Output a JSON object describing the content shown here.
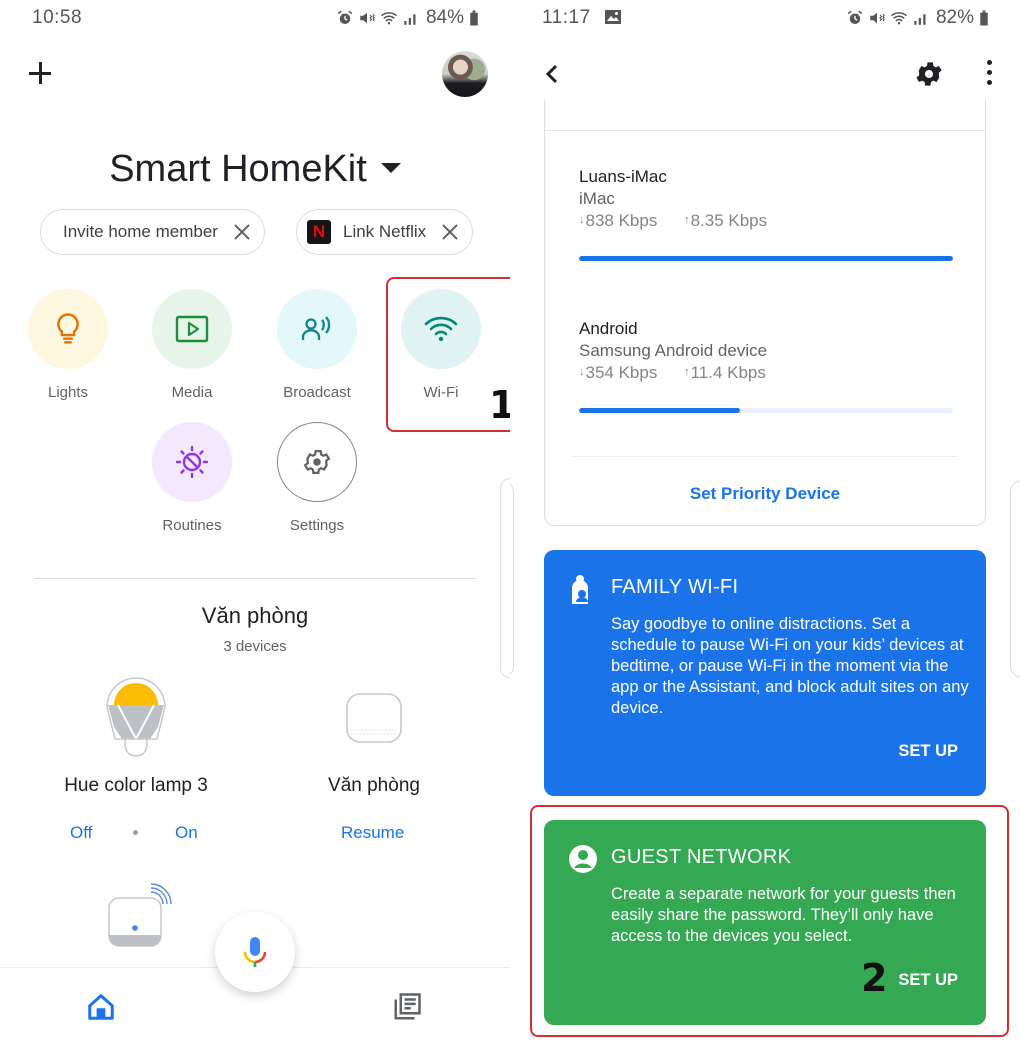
{
  "left_screen": {
    "status_bar": {
      "time": "10:58",
      "icons": [
        "alarm-icon",
        "mute-vibrate-icon",
        "wifi-icon",
        "signal-icon"
      ],
      "battery": "84%"
    },
    "header": {
      "add_icon": "plus-icon",
      "avatar": "profile-photo"
    },
    "home_title": "Smart HomeKit",
    "chips": [
      {
        "label": "Invite home member",
        "icon": "close-icon"
      },
      {
        "label": "Link Netflix",
        "logo": "N",
        "icon": "close-icon"
      }
    ],
    "shortcuts": [
      {
        "label": "Lights",
        "icon": "lightbulb-icon",
        "bg": "#fef7e0",
        "color": "#e37400"
      },
      {
        "label": "Media",
        "icon": "play-icon",
        "bg": "#e6f4ea",
        "color": "#1e8e3e"
      },
      {
        "label": "Broadcast",
        "icon": "broadcast-icon",
        "bg": "#e4f7fb",
        "color": "#12838f"
      },
      {
        "label": "Wi-Fi",
        "icon": "wifi-icon",
        "bg": "#e0f2f1",
        "color": "#00897b"
      },
      {
        "label": "Routines",
        "icon": "routines-icon",
        "bg": "#f3e8fd",
        "color": "#9334e6"
      },
      {
        "label": "Settings",
        "icon": "gear-icon",
        "bg": "#ffffff",
        "color": "#5f6368"
      }
    ],
    "annotation_1": "1",
    "room": {
      "name": "Văn phòng",
      "count": "3 devices",
      "devices": [
        {
          "name": "Hue color lamp 3",
          "actions": [
            "Off",
            "On"
          ]
        },
        {
          "name": "Văn phòng",
          "actions": [
            "Resume"
          ]
        }
      ]
    },
    "bottom_nav": {
      "items": [
        "home-icon",
        "microphone-icon",
        "feed-icon"
      ]
    }
  },
  "right_screen": {
    "status_bar": {
      "time": "11:17",
      "icons": [
        "image-icon",
        "alarm-icon",
        "mute-vibrate-icon",
        "wifi-icon",
        "signal-icon"
      ],
      "battery": "82%"
    },
    "header": {
      "back_icon": "back-icon",
      "settings_icon": "gear-icon",
      "more_icon": "more-vert-icon"
    },
    "devices": [
      {
        "name": "Luans-iMac",
        "type": "iMac",
        "down": "838 Kbps",
        "up": "8.35 Kbps",
        "usage_fraction": 1.0
      },
      {
        "name": "Android",
        "type": "Samsung Android device",
        "down": "354 Kbps",
        "up": "11.4 Kbps",
        "usage_fraction": 0.43
      }
    ],
    "priority_link": "Set Priority Device",
    "family_wifi": {
      "title": "FAMILY WI-FI",
      "body": "Say goodbye to online distractions. Set a schedule to pause Wi-Fi on your kids’ devices at bedtime, or pause Wi-Fi in the moment via the app or the Assistant, and block adult sites on any device.",
      "button": "SET UP",
      "color": "#1a73e8"
    },
    "guest_network": {
      "title": "GUEST NETWORK",
      "body": "Create a separate network for your guests then easily share the password. They’ll only have access to the devices you select.",
      "button": "SET UP",
      "color": "#34a853"
    },
    "annotation_2": "2"
  },
  "colors": {
    "accent_blue": "#1a73e8",
    "highlight_red": "#d32f2f",
    "text_primary": "#202124",
    "text_secondary": "#5f6368"
  }
}
